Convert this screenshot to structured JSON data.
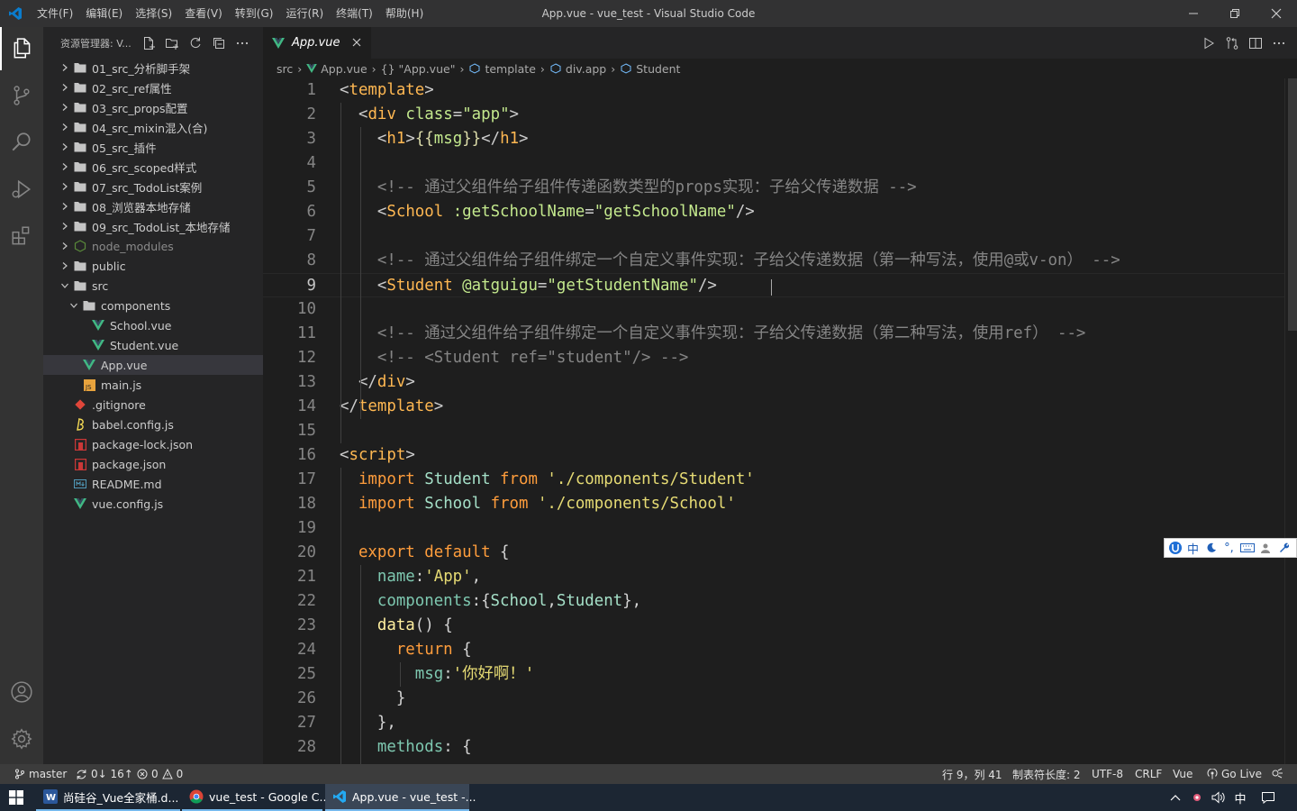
{
  "window": {
    "title": "App.vue - vue_test - Visual Studio Code",
    "menu": [
      "文件(F)",
      "编辑(E)",
      "选择(S)",
      "查看(V)",
      "转到(G)",
      "运行(R)",
      "终端(T)",
      "帮助(H)"
    ]
  },
  "sidebar": {
    "title": "资源管理器: V...",
    "tree": [
      {
        "label": "01_src_分析脚手架",
        "kind": "folder",
        "depth": 0,
        "open": false
      },
      {
        "label": "02_src_ref属性",
        "kind": "folder",
        "depth": 0,
        "open": false
      },
      {
        "label": "03_src_props配置",
        "kind": "folder",
        "depth": 0,
        "open": false
      },
      {
        "label": "04_src_mixin混入(合)",
        "kind": "folder",
        "depth": 0,
        "open": false
      },
      {
        "label": "05_src_插件",
        "kind": "folder",
        "depth": 0,
        "open": false
      },
      {
        "label": "06_src_scoped样式",
        "kind": "folder",
        "depth": 0,
        "open": false
      },
      {
        "label": "07_src_TodoList案例",
        "kind": "folder",
        "depth": 0,
        "open": false
      },
      {
        "label": "08_浏览器本地存储",
        "kind": "folder",
        "depth": 0,
        "open": false
      },
      {
        "label": "09_src_TodoList_本地存储",
        "kind": "folder",
        "depth": 0,
        "open": false
      },
      {
        "label": "node_modules",
        "kind": "node",
        "depth": 0,
        "open": false
      },
      {
        "label": "public",
        "kind": "folder",
        "depth": 0,
        "open": false
      },
      {
        "label": "src",
        "kind": "folder",
        "depth": 0,
        "open": true
      },
      {
        "label": "components",
        "kind": "folder",
        "depth": 1,
        "open": true
      },
      {
        "label": "School.vue",
        "kind": "vue",
        "depth": 2
      },
      {
        "label": "Student.vue",
        "kind": "vue",
        "depth": 2
      },
      {
        "label": "App.vue",
        "kind": "vue",
        "depth": 1,
        "selected": true
      },
      {
        "label": "main.js",
        "kind": "js",
        "depth": 1
      },
      {
        "label": ".gitignore",
        "kind": "git",
        "depth": 0
      },
      {
        "label": "babel.config.js",
        "kind": "babel",
        "depth": 0
      },
      {
        "label": "package-lock.json",
        "kind": "npm",
        "depth": 0
      },
      {
        "label": "package.json",
        "kind": "npm",
        "depth": 0
      },
      {
        "label": "README.md",
        "kind": "md",
        "depth": 0
      },
      {
        "label": "vue.config.js",
        "kind": "vue",
        "depth": 0
      }
    ]
  },
  "tab": {
    "label": "App.vue"
  },
  "breadcrumb": [
    "src",
    "App.vue",
    "{} \"App.vue\"",
    "template",
    "div.app",
    "Student"
  ],
  "editor": {
    "current_line": 9,
    "lines": [
      [
        [
          "t-punc",
          "<"
        ],
        [
          "t-tag",
          "template"
        ],
        [
          "t-punc",
          ">"
        ]
      ],
      [
        [
          "",
          "  "
        ],
        [
          "t-punc",
          "<"
        ],
        [
          "t-tag",
          "div"
        ],
        [
          "t-def",
          " "
        ],
        [
          "t-attr",
          "class"
        ],
        [
          "t-punc",
          "="
        ],
        [
          "t-str",
          "\"app\""
        ],
        [
          "t-punc",
          ">"
        ]
      ],
      [
        [
          "",
          "    "
        ],
        [
          "t-punc",
          "<"
        ],
        [
          "t-tag",
          "h1"
        ],
        [
          "t-punc",
          ">"
        ],
        [
          "t-mus",
          "{{"
        ],
        [
          "t-attr",
          "msg"
        ],
        [
          "t-mus",
          "}}"
        ],
        [
          "t-punc",
          "</"
        ],
        [
          "t-tag",
          "h1"
        ],
        [
          "t-punc",
          ">"
        ]
      ],
      [],
      [
        [
          "",
          "    "
        ],
        [
          "t-com",
          "<!-- 通过父组件给子组件传递函数类型的props实现：子给父传递数据 -->"
        ]
      ],
      [
        [
          "",
          "    "
        ],
        [
          "t-punc",
          "<"
        ],
        [
          "t-tag",
          "School"
        ],
        [
          "t-def",
          " "
        ],
        [
          "t-attr",
          ":getSchoolName"
        ],
        [
          "t-punc",
          "="
        ],
        [
          "t-str",
          "\"getSchoolName\""
        ],
        [
          "t-punc",
          "/>"
        ]
      ],
      [],
      [
        [
          "",
          "    "
        ],
        [
          "t-com",
          "<!-- 通过父组件给子组件绑定一个自定义事件实现：子给父传递数据（第一种写法，使用@或v-on） -->"
        ]
      ],
      [
        [
          "",
          "    "
        ],
        [
          "t-punc",
          "<"
        ],
        [
          "t-tag",
          "Student"
        ],
        [
          "t-def",
          " "
        ],
        [
          "t-attr",
          "@atguigu"
        ],
        [
          "t-punc",
          "="
        ],
        [
          "t-str",
          "\"getStudentName\""
        ],
        [
          "t-punc",
          "/>"
        ]
      ],
      [],
      [
        [
          "",
          "    "
        ],
        [
          "t-com",
          "<!-- 通过父组件给子组件绑定一个自定义事件实现：子给父传递数据（第二种写法，使用ref） -->"
        ]
      ],
      [
        [
          "",
          "    "
        ],
        [
          "t-com",
          "<!-- <Student ref=\"student\"/> -->"
        ]
      ],
      [
        [
          "",
          "  "
        ],
        [
          "t-punc",
          "</"
        ],
        [
          "t-tag",
          "div"
        ],
        [
          "t-punc",
          ">"
        ]
      ],
      [
        [
          "t-punc",
          "</"
        ],
        [
          "t-tag",
          "template"
        ],
        [
          "t-punc",
          ">"
        ]
      ],
      [],
      [
        [
          "t-punc",
          "<"
        ],
        [
          "t-tag",
          "script"
        ],
        [
          "t-punc",
          ">"
        ]
      ],
      [
        [
          "",
          "  "
        ],
        [
          "t-kw",
          "import"
        ],
        [
          "t-def",
          " "
        ],
        [
          "t-id",
          "Student"
        ],
        [
          "t-def",
          " "
        ],
        [
          "t-kw",
          "from"
        ],
        [
          "t-def",
          " "
        ],
        [
          "t-str2",
          "'./components/Student'"
        ]
      ],
      [
        [
          "",
          "  "
        ],
        [
          "t-kw",
          "import"
        ],
        [
          "t-def",
          " "
        ],
        [
          "t-id",
          "School"
        ],
        [
          "t-def",
          " "
        ],
        [
          "t-kw",
          "from"
        ],
        [
          "t-def",
          " "
        ],
        [
          "t-str2",
          "'./components/School'"
        ]
      ],
      [],
      [
        [
          "",
          "  "
        ],
        [
          "t-kw",
          "export"
        ],
        [
          "t-def",
          " "
        ],
        [
          "t-kw",
          "default"
        ],
        [
          "t-def",
          " {"
        ]
      ],
      [
        [
          "",
          "    "
        ],
        [
          "t-prop",
          "name"
        ],
        [
          "t-def",
          ":"
        ],
        [
          "t-str2",
          "'App'"
        ],
        [
          "t-def",
          ","
        ]
      ],
      [
        [
          "",
          "    "
        ],
        [
          "t-prop",
          "components"
        ],
        [
          "t-def",
          ":{"
        ],
        [
          "t-id",
          "School"
        ],
        [
          "t-def",
          ","
        ],
        [
          "t-id",
          "Student"
        ],
        [
          "t-def",
          "},"
        ]
      ],
      [
        [
          "",
          "    "
        ],
        [
          "t-fn",
          "data"
        ],
        [
          "t-def",
          "() {"
        ]
      ],
      [
        [
          "",
          "      "
        ],
        [
          "t-kw",
          "return"
        ],
        [
          "t-def",
          " {"
        ]
      ],
      [
        [
          "",
          "        "
        ],
        [
          "t-prop",
          "msg"
        ],
        [
          "t-def",
          ":"
        ],
        [
          "t-str2",
          "'你好啊！'"
        ]
      ],
      [
        [
          "",
          "      "
        ],
        [
          "t-def",
          "}"
        ]
      ],
      [
        [
          "",
          "    "
        ],
        [
          "t-def",
          "},"
        ]
      ],
      [
        [
          "",
          "    "
        ],
        [
          "t-prop",
          "methods"
        ],
        [
          "t-def",
          ": {"
        ]
      ]
    ]
  },
  "ime": {
    "lang": "中"
  },
  "statusbar": {
    "branch": "master",
    "sync": "0↓ 16↑",
    "errors": "0",
    "warnings": "0",
    "position": "行 9，列 41",
    "tab_size": "制表符长度: 2",
    "encoding": "UTF-8",
    "eol": "CRLF",
    "language": "Vue",
    "go_live": "Go Live"
  },
  "taskbar": {
    "tasks": [
      "尚硅谷_Vue全家桶.d...",
      "vue_test - Google C...",
      "App.vue - vue_test -..."
    ],
    "ime": "中"
  },
  "colors": {
    "accent": "#007acc",
    "vue_green": "#41b883",
    "folder": "#c5c5c5"
  }
}
